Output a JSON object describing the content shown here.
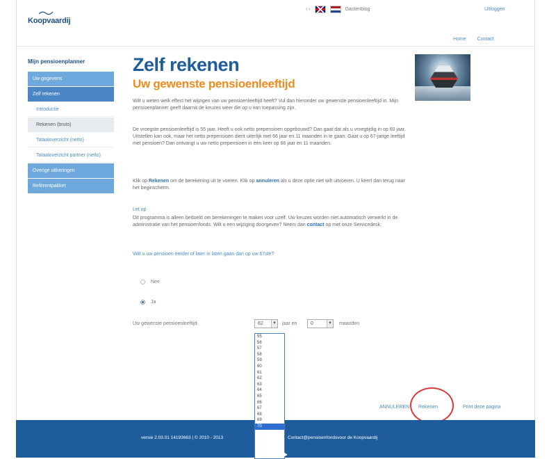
{
  "header": {
    "logo": "Koopvaardij",
    "util_arrows": "‹  ›",
    "util_link": "Gastenblog",
    "logout": "Uitloggen",
    "nav": [
      "Home",
      "Contact"
    ]
  },
  "sidebar": {
    "title": "Mijn pensioenplanner",
    "items": [
      {
        "label": "Uw gegevens",
        "kind": "main"
      },
      {
        "label": "Zelf rekenen",
        "kind": "active"
      },
      {
        "label": "Introductie",
        "kind": "sub"
      },
      {
        "label": "Rekenen (bruto)",
        "kind": "current"
      },
      {
        "label": "Totaaloverzicht (netto)",
        "kind": "sub"
      },
      {
        "label": "Totaaloverzicht partner (netto)",
        "kind": "sub"
      },
      {
        "label": "Overige uitkeringen",
        "kind": "main"
      },
      {
        "label": "Referentpakket",
        "kind": "main"
      }
    ]
  },
  "content": {
    "title": "Zelf rekenen",
    "subtitle": "Uw gewenste pensioenleeftijd",
    "p1": "Wilt u weten welk effect het wijzigen van uw pensioenleeftijd heeft? Vul dan hieronder uw gewenste pensioenleeftijd in. Mijn pensioenplanner geeft daarna de keuzes weer die op u van toepassing zijn.",
    "p2": "De vroegste pensioenleeftijd is 55 jaar. Heeft u ook netto prepensioen opgebouwd? Dan gaat dat als u vroegtijdig in op 60 jaar. Uitstellen kan ook, maar het netto prepensioen dient uiterlijk met 66 jaar en 11 maanden in te gaan. Gaat u op 67-jarige leeftijd met pensioen? Dan ontvangt u uw netto prepensioen in één keer op 66 jaar en 11 maanden.",
    "p3_a": "Klik op ",
    "p3_link1": "Rekenen",
    "p3_b": " om de berekening uit te voeren. Klik op ",
    "p3_link2": "annuleren",
    "p3_c": " als u deze optie niet wilt uitvoeren. U keert dan terug naar het beginscherm.",
    "let_op": "Let op",
    "p4_a": "Dit programma is alleen bedoeld om berekeningen te maken voor uzelf. Uw keuzes worden niet automatisch verwerkt in de administratie van het pensioenfonds. Wilt u een wijziging doorgeven? Neem dan ",
    "p4_link": "contact",
    "p4_b": " op met onze Servicedesk.",
    "question": "Wilt u uw pensioen eerder of later in laten gaan dan op uw 67ste?",
    "radio_no": "Nee",
    "radio_yes": "Ja",
    "age_label": "Uw gewenste pensioenleeftijd",
    "years_value": "62",
    "years_text": "jaar en",
    "months_value": "0",
    "months_text": "maanden"
  },
  "dropdown_options": [
    "55",
    "56",
    "57",
    "58",
    "59",
    "60",
    "61",
    "62",
    "63",
    "64",
    "65",
    "66",
    "67",
    "68",
    "69",
    "70"
  ],
  "dropdown_selected": "70",
  "actions": {
    "back": "ANNULEREN",
    "calc": "Rekenen",
    "print": "Print deze pagina"
  },
  "footer": {
    "left": "versie 2.03.01  14193663  |  © 2010 - 2013",
    "right": "Contact@pensioenfondsvoor de Koopvaardij"
  },
  "colors": {
    "brand_blue": "#1f5c9c",
    "accent_orange": "#f08a1c",
    "sidebar_blue": "#6fa8dc",
    "annotation_red": "#d93a3a"
  }
}
